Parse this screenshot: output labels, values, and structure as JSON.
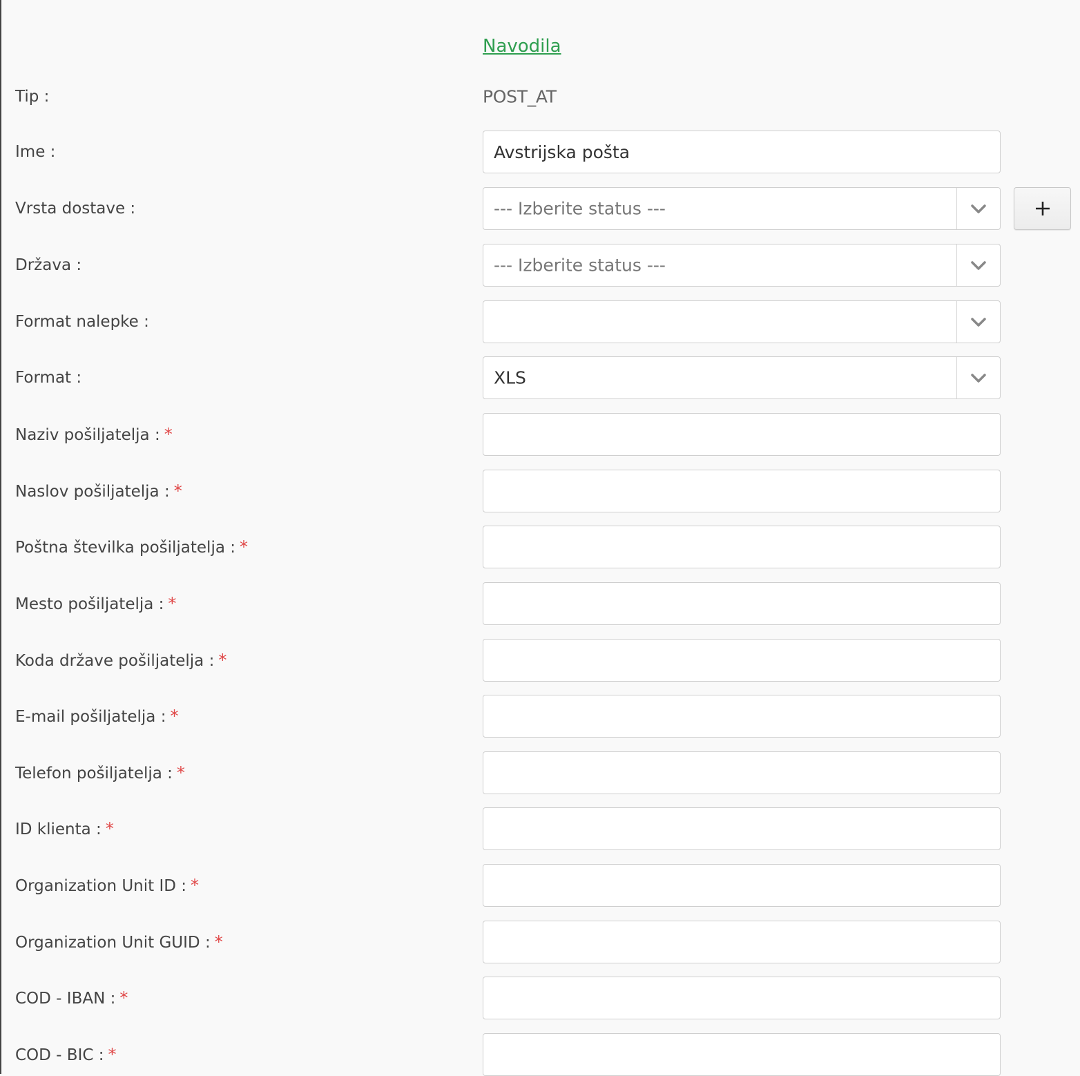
{
  "instructions_link": "Navodila",
  "fields": {
    "tip": {
      "label": "Tip :",
      "value": "POST_AT"
    },
    "ime": {
      "label": "Ime :",
      "value": "Avstrijska pošta"
    },
    "vrsta_dostave": {
      "label": "Vrsta dostave :",
      "placeholder": "--- Izberite status ---",
      "add_button": "+"
    },
    "drzava": {
      "label": "Država :",
      "placeholder": "--- Izberite status ---"
    },
    "format_nalepke": {
      "label": "Format nalepke :",
      "value": ""
    },
    "format": {
      "label": "Format :",
      "value": "XLS"
    },
    "naziv_posiljatelja": {
      "label": "Naziv pošiljatelja :",
      "required": "*",
      "value": ""
    },
    "naslov_posiljatelja": {
      "label": "Naslov pošiljatelja :",
      "required": "*",
      "value": ""
    },
    "postna_stevilka": {
      "label": "Poštna številka pošiljatelja :",
      "required": "*",
      "value": ""
    },
    "mesto_posiljatelja": {
      "label": "Mesto pošiljatelja :",
      "required": "*",
      "value": ""
    },
    "koda_drzave": {
      "label": "Koda države pošiljatelja :",
      "required": "*",
      "value": ""
    },
    "email_posiljatelja": {
      "label": "E-mail pošiljatelja :",
      "required": "*",
      "value": ""
    },
    "telefon_posiljatelja": {
      "label": "Telefon pošiljatelja :",
      "required": "*",
      "value": ""
    },
    "id_klienta": {
      "label": "ID klienta :",
      "required": "*",
      "value": ""
    },
    "org_unit_id": {
      "label": "Organization Unit ID :",
      "required": "*",
      "value": ""
    },
    "org_unit_guid": {
      "label": "Organization Unit GUID :",
      "required": "*",
      "value": ""
    },
    "cod_iban": {
      "label": "COD - IBAN :",
      "required": "*",
      "value": ""
    },
    "cod_bic": {
      "label": "COD - BIC :",
      "required": "*",
      "value": ""
    }
  },
  "icons": {
    "dropdown": "chevron-down-icon",
    "add": "plus-icon"
  },
  "colors": {
    "link": "#2e9e4f",
    "required": "#e04848",
    "background": "#f9f9f9"
  }
}
